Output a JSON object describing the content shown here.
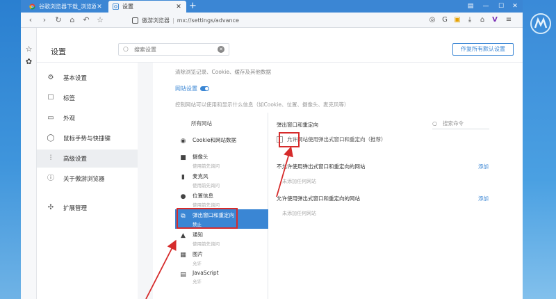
{
  "colors": {
    "accent": "#3a86d4",
    "annotation": "#d62b2b",
    "desktop": "#2a7fd0"
  },
  "tabs": [
    {
      "title": "谷歌浏览器下载_浏览器",
      "icon": "chrome-icon",
      "active": false
    },
    {
      "title": "设置",
      "icon": "settings-page-icon",
      "active": true
    }
  ],
  "window_controls": [
    "menu-icon",
    "minimize-icon",
    "maximize-icon",
    "close-icon"
  ],
  "address": {
    "site_name": "傲游浏览器",
    "url": "mx://settings/advance"
  },
  "toolbar_right": [
    "camera-icon",
    "refresh-g-icon",
    "note-icon",
    "download-icon",
    "gift-icon",
    "v-icon",
    "hamburger-icon"
  ],
  "settings": {
    "title": "设置",
    "search_placeholder": "搜索设置",
    "default_button": "作为默认浏览器",
    "default_button_full": "作复所有默认设置"
  },
  "nav": [
    {
      "label": "基本设置",
      "icon": "gear-icon"
    },
    {
      "label": "标签",
      "icon": "tab-icon"
    },
    {
      "label": "外观",
      "icon": "appearance-icon"
    },
    {
      "label": "鼠标手势与快捷键",
      "icon": "mouse-icon"
    },
    {
      "label": "高级设置",
      "icon": "sliders-icon",
      "active": true
    },
    {
      "label": "关于傲游浏览器",
      "icon": "info-icon"
    },
    {
      "label": "扩展管理",
      "icon": "puzzle-icon"
    }
  ],
  "main": {
    "clear_line": "清除浏览记录、Cookie、缓存及其他数据",
    "site_settings": "网站设置",
    "site_desc": "控制网站可以使用和显示什么信息（如Cookie、位置、摄像头、麦克风等）",
    "all_sites": "所有网站",
    "permissions": [
      {
        "name": "Cookie和网站数据",
        "sub": "",
        "icon": "cookie-icon"
      },
      {
        "name": "摄像头",
        "sub": "使用前先询问",
        "icon": "camera-video-icon"
      },
      {
        "name": "麦克风",
        "sub": "使用前先询问",
        "icon": "microphone-icon"
      },
      {
        "name": "位置信息",
        "sub": "使用前先询问",
        "icon": "location-icon"
      },
      {
        "name": "弹出窗口和重定向",
        "sub": "禁止",
        "icon": "popup-icon",
        "active": true
      },
      {
        "name": "通知",
        "sub": "使用前先询问",
        "icon": "bell-icon"
      },
      {
        "name": "图片",
        "sub": "允许",
        "icon": "image-icon"
      },
      {
        "name": "JavaScript",
        "sub": "允许",
        "icon": "javascript-icon"
      }
    ],
    "right": {
      "title": "弹出窗口和重定向",
      "search_placeholder": "搜索命令",
      "allow_label": "允许网站使用弹出式窗口和重定向（推荐）",
      "allow_checked": false,
      "sections": [
        {
          "title": "不允许使用弹出式窗口和重定向的网站",
          "add": "添加",
          "empty": "未添加任何网站"
        },
        {
          "title": "允许使用弹出式窗口和重定向的网站",
          "add": "添加",
          "empty": "未添加任何网站"
        }
      ]
    }
  }
}
